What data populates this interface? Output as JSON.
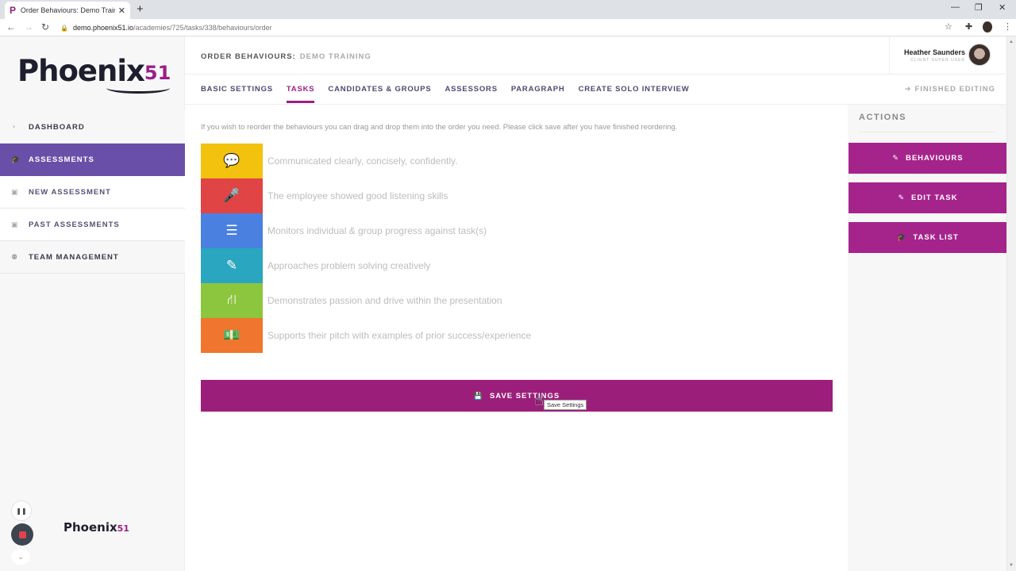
{
  "browser": {
    "tab_title": "Order Behaviours: Demo Training",
    "favicon": "P",
    "url_host": "demo.phoenix51.io",
    "url_path": "/academies/725/tasks/338/behaviours/order"
  },
  "brand": {
    "name": "Phoenix",
    "number": "51"
  },
  "sidebar": {
    "items": [
      {
        "label": "DASHBOARD",
        "icon": "dashboard-icon",
        "glyph": "◔",
        "active": false
      },
      {
        "label": "ASSESSMENTS",
        "icon": "graduation-cap-icon",
        "glyph": "🎓",
        "active": true
      },
      {
        "label": "NEW ASSESSMENT",
        "icon": "calendar-plus-icon",
        "glyph": "▣",
        "active": false
      },
      {
        "label": "PAST ASSESSMENTS",
        "icon": "calendar-minus-icon",
        "glyph": "▣",
        "active": false
      },
      {
        "label": "TEAM MANAGEMENT",
        "icon": "users-icon",
        "glyph": "⚉",
        "active": false
      }
    ]
  },
  "header": {
    "title": "ORDER BEHAVIOURS:",
    "subtitle": "DEMO TRAINING"
  },
  "user": {
    "name": "Heather Saunders",
    "role": "CLIENT SUPER USER"
  },
  "tabs": [
    {
      "label": "BASIC SETTINGS",
      "active": false
    },
    {
      "label": "TASKS",
      "active": true
    },
    {
      "label": "CANDIDATES & GROUPS",
      "active": false
    },
    {
      "label": "ASSESSORS",
      "active": false
    },
    {
      "label": "PARAGRAPH",
      "active": false
    },
    {
      "label": "CREATE SOLO INTERVIEW",
      "active": false
    }
  ],
  "finished_editing": "FINISHED EDITING",
  "main": {
    "hint": "If you wish to reorder the behaviours you can drag and drop them into the order you need. Please click save after you have finished reordering.",
    "behaviours": [
      {
        "label": "Communicated clearly, concisely, confidently.",
        "icon": "comment-icon",
        "glyph": "💬",
        "color": "#f2c20f"
      },
      {
        "label": "The employee showed good listening skills",
        "icon": "microphone-icon",
        "glyph": "🎤",
        "color": "#e04444"
      },
      {
        "label": "Monitors individual & group progress against task(s)",
        "icon": "table-list-icon",
        "glyph": "☰",
        "color": "#4a80e0"
      },
      {
        "label": "Approaches problem solving creatively",
        "icon": "pencil-icon",
        "glyph": "✎",
        "color": "#2aa6c0"
      },
      {
        "label": "Demonstrates passion and drive within the presentation",
        "icon": "road-icon",
        "glyph": "⛙",
        "color": "#8cc63f"
      },
      {
        "label": "Supports their pitch with examples of prior success/experience",
        "icon": "money-icon",
        "glyph": "💵",
        "color": "#f0752e"
      }
    ],
    "save_label": "SAVE SETTINGS",
    "save_tooltip": "Save Settings"
  },
  "actions": {
    "heading": "ACTIONS",
    "buttons": [
      {
        "label": "BEHAVIOURS",
        "icon": "pencil-icon",
        "glyph": "✎"
      },
      {
        "label": "EDIT TASK",
        "icon": "pencil-icon",
        "glyph": "✎"
      },
      {
        "label": "TASK LIST",
        "icon": "graduation-cap-icon",
        "glyph": "🎓"
      }
    ]
  },
  "colors": {
    "brand_purple": "#9b1f86",
    "sidebar_active": "#6a4fa8",
    "action_button": "#a5248b",
    "save_button": "#9b1f7a"
  }
}
